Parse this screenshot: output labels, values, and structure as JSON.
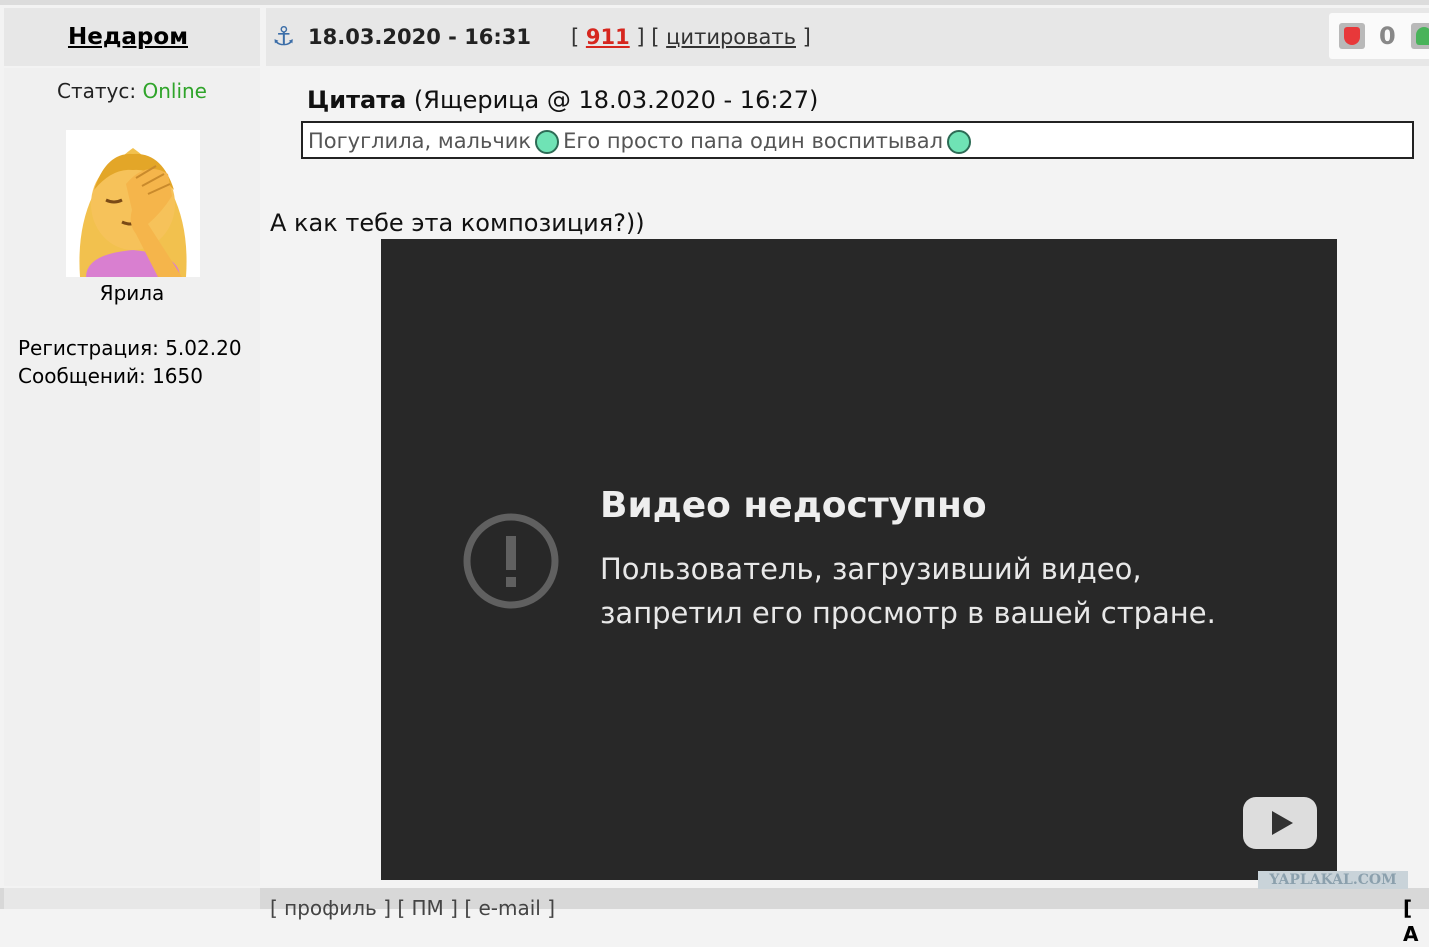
{
  "header": {
    "author": "Недаром",
    "date": "18.03.2020 - 16:31",
    "open_bracket": "[ ",
    "post_number": "911",
    "mid_brackets": " ] [ ",
    "quote_link": "цитировать",
    "close_bracket": " ]",
    "rating": "0"
  },
  "profile": {
    "status_label": "Статус: ",
    "status_value": "Online",
    "rank": "Ярила",
    "registration": "Регистрация: 5.02.20",
    "messages": "Сообщений: 1650"
  },
  "post": {
    "quote_title_bold": "Цитата",
    "quote_title_rest": " (Ящерица @ 18.03.2020 - 16:27)",
    "quote_part1": "Погуглила, мальчик",
    "quote_part2": "Его просто папа один воспитывал",
    "text": "А как тебе эта композиция?))"
  },
  "video": {
    "title": "Видео недоступно",
    "message": "Пользователь, загрузивший видео, запретил его просмотр в вашей стране."
  },
  "watermark": "YAPLAKAL.COM",
  "footer": {
    "links": "[ профиль ] [ ПМ ] [ e-mail ]",
    "right": "[ A"
  },
  "colors": {
    "online": "#2fa42a",
    "post_number": "#d6261e",
    "anchor": "#3c6ea8",
    "video_bg": "#282828"
  }
}
